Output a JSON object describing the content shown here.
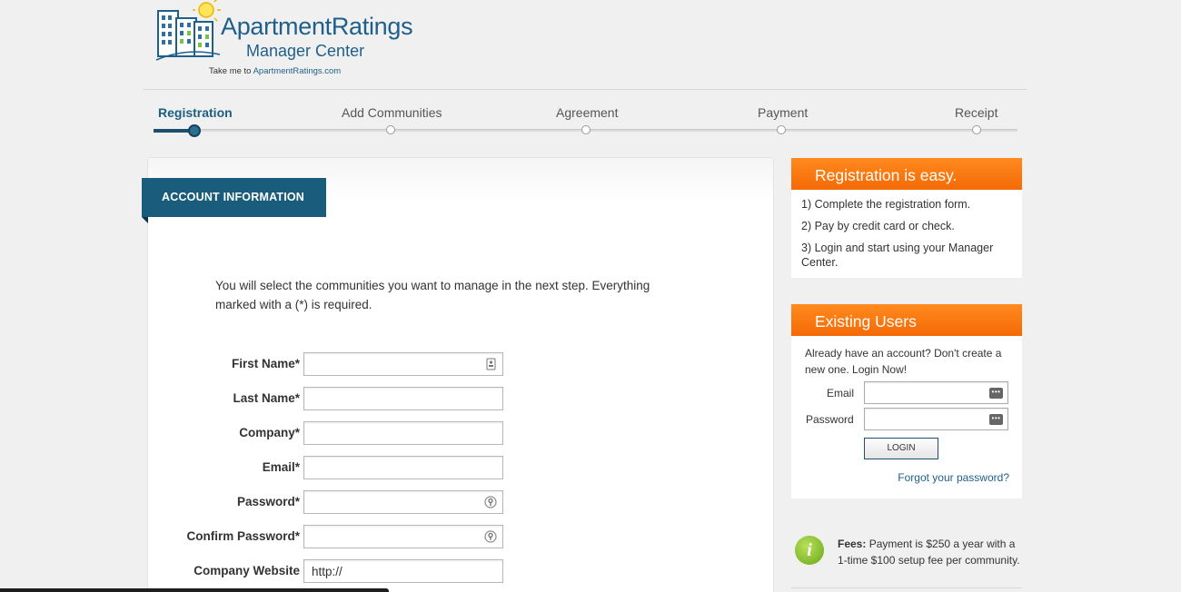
{
  "header": {
    "logo_title": "ApartmentRatings",
    "logo_subtitle": "Manager Center",
    "take_me_prefix": "Take me to",
    "take_me_link": "ApartmentRatings.com"
  },
  "stepper": {
    "steps": [
      {
        "label": "Registration",
        "active": true
      },
      {
        "label": "Add Communities",
        "active": false
      },
      {
        "label": "Agreement",
        "active": false
      },
      {
        "label": "Payment",
        "active": false
      },
      {
        "label": "Receipt",
        "active": false
      }
    ]
  },
  "account": {
    "section_title": "ACCOUNT INFORMATION",
    "intro": "You will select the communities you want to manage in the next step. Everything marked with a (*) is required.",
    "fields": [
      {
        "label": "First Name*",
        "value": "",
        "icon": "contact-card-icon"
      },
      {
        "label": "Last Name*",
        "value": ""
      },
      {
        "label": "Company*",
        "value": ""
      },
      {
        "label": "Email*",
        "value": ""
      },
      {
        "label": "Password*",
        "value": "",
        "icon": "key-icon"
      },
      {
        "label": "Confirm Password*",
        "value": "",
        "icon": "key-icon"
      },
      {
        "label": "Company Website",
        "value": "http://"
      }
    ]
  },
  "registration_easy": {
    "title": "Registration is easy.",
    "steps": [
      "1) Complete the registration form.",
      "2) Pay by credit card or check.",
      "3) Login and start using your Manager Center."
    ]
  },
  "existing_users": {
    "title": "Existing Users",
    "message": "Already have an account? Don't create a new one. Login Now!",
    "email_label": "Email",
    "password_label": "Password",
    "login_button": "LOGIN",
    "forgot_link": "Forgot your password?"
  },
  "fees": {
    "label": "Fees:",
    "text": " Payment is $250 a year with a 1-time $100 setup fee per community."
  },
  "colors": {
    "brand_blue": "#1a5c7b",
    "accent_orange": "#f46a06",
    "info_green": "#6aa618"
  }
}
